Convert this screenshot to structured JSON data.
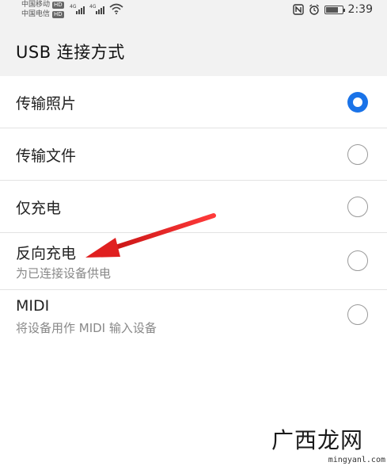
{
  "status_bar": {
    "carrier_1": "中国移动",
    "carrier_2": "中国电信",
    "hd_badge": "HD",
    "network_1": "4G",
    "network_2": "4G",
    "time": "2:39",
    "icons": [
      "nfc-icon",
      "alarm-icon",
      "battery-icon",
      "wifi-icon",
      "signal-icon"
    ]
  },
  "header": {
    "title": "USB 连接方式"
  },
  "options": [
    {
      "label": "传输照片",
      "subtitle": "",
      "selected": true
    },
    {
      "label": "传输文件",
      "subtitle": "",
      "selected": false
    },
    {
      "label": "仅充电",
      "subtitle": "",
      "selected": false
    },
    {
      "label": "反向充电",
      "subtitle": "为已连接设备供电",
      "selected": false
    },
    {
      "label": "MIDI",
      "subtitle": "将设备用作 MIDI 输入设备",
      "selected": false
    }
  ],
  "annotation": {
    "arrow_color": "#e02020"
  },
  "colors": {
    "accent": "#1a73e8",
    "header_bg": "#f2f2f2",
    "divider": "#e3e3e3"
  },
  "watermark": {
    "text": "广西龙网",
    "url": "mingyanl.com"
  }
}
